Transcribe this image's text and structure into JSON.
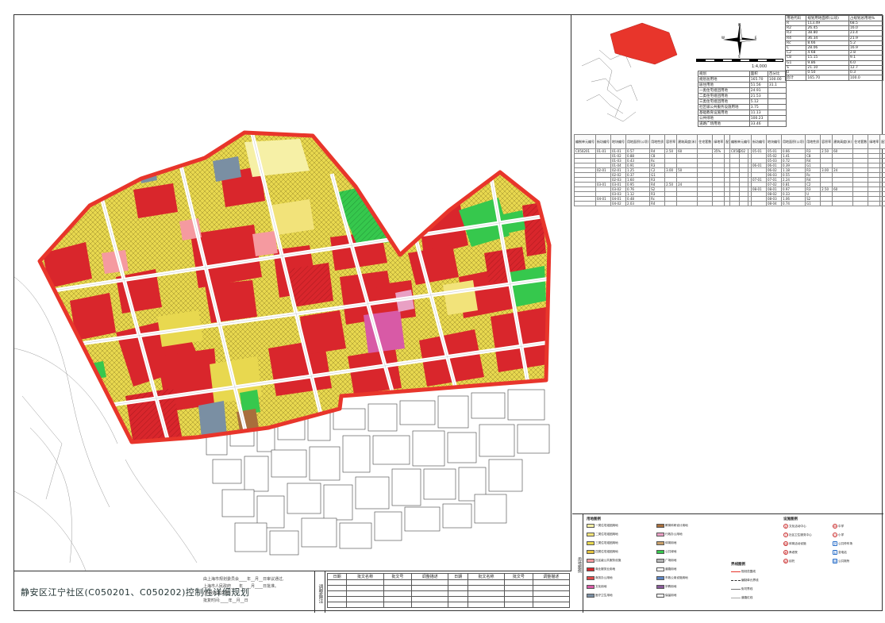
{
  "plan_title": "静安区江宁社区(C050201、C050202)控制性详细规划",
  "approval_lines": [
    "由上海市规划委员会____年__月__日审议通过,",
    "上海市人民政府____年____月____日批准。",
    "(市政府批文号)",
    "批复时间:____年__月__日"
  ],
  "adjust_label": "调整备注",
  "adjust_headers": [
    "日期",
    "批文名称",
    "批文号",
    "调整描述",
    "日期",
    "批文名称",
    "批文号",
    "调整描述"
  ],
  "scale_text": "1:4,000",
  "compass_labels": [
    "N",
    "S",
    "E",
    "W"
  ],
  "stats_rows": [
    [
      "规划",
      "面积",
      "百分比"
    ],
    [
      "规划总用地",
      "165.70",
      "100.00"
    ],
    [
      "居住用地",
      "51.56",
      "31.1"
    ],
    [
      "一类住宅组团用地",
      "24.91",
      ""
    ],
    [
      "二类住宅组团用地",
      "21.53",
      ""
    ],
    [
      "三类住宅组团用地",
      "5.12",
      ""
    ],
    [
      "社区级公共服务设施用地",
      "3.75",
      ""
    ],
    [
      "基础教育设施用地",
      "11.13",
      ""
    ],
    [
      "公共绿地",
      "100.23",
      ""
    ],
    [
      "道路广场用地",
      "33.46",
      ""
    ]
  ],
  "land_rows": [
    [
      "用地代码",
      "规划用地面积(公顷)",
      "占规划总用地%"
    ],
    [
      "R",
      "113.49",
      "68.5"
    ],
    [
      "R2",
      "26.45",
      "16.0"
    ],
    [
      "R3",
      "38.80",
      "23.4"
    ],
    [
      "R4",
      "36.34",
      "21.9"
    ],
    [
      "Rc",
      "8.66",
      "5.2"
    ],
    [
      "C",
      "28.06",
      "16.9"
    ],
    [
      "C2",
      "4.68",
      "2.8"
    ],
    [
      "C8",
      "15.15",
      "9.1"
    ],
    [
      "G1",
      "9.86",
      "6.0"
    ],
    [
      "S",
      "21.10",
      "12.7"
    ],
    [
      "U",
      "0.50",
      "0.3"
    ],
    [
      "合计",
      "165.70",
      "100.0"
    ]
  ],
  "block_table_headers": [
    "编制单元编号",
    "街坊编号",
    "地块编号",
    "用地面积(公顷)",
    "用地性质",
    "容积率",
    "建筑高度(米)",
    "住宅套数",
    "绿地率",
    "配套设施",
    "备注"
  ],
  "block_rows_left": [
    [
      "C050201",
      "01-01",
      "01-01",
      "0.57",
      "R4",
      "2.50",
      "60",
      "",
      "35%",
      "",
      ""
    ],
    [
      "",
      "",
      "01-02",
      "0.88",
      "C8",
      "",
      "",
      "",
      "",
      "",
      ""
    ],
    [
      "",
      "",
      "01-03",
      "0.43",
      "Rc",
      "",
      "",
      "",
      "",
      "",
      ""
    ],
    [
      "",
      "",
      "01-04",
      "0.91",
      "R3",
      "",
      "",
      "",
      "",
      "",
      ""
    ],
    [
      "",
      "02-01",
      "02-01",
      "1.25",
      "C2",
      "3.00",
      "50",
      "",
      "",
      "",
      ""
    ],
    [
      "",
      "",
      "02-02",
      "0.37",
      "G1",
      "",
      "",
      "",
      "",
      "",
      ""
    ],
    [
      "",
      "",
      "02-03",
      "1.60",
      "R3",
      "",
      "",
      "",
      "",
      "",
      ""
    ],
    [
      "",
      "03-01",
      "03-01",
      "0.95",
      "R4",
      "2.50",
      "24",
      "",
      "",
      "",
      ""
    ],
    [
      "",
      "",
      "03-02",
      "0.76",
      "S2",
      "",
      "",
      "",
      "",
      "",
      ""
    ],
    [
      "",
      "",
      "03-03",
      "1.12",
      "R3",
      "",
      "",
      "",
      "",
      "",
      ""
    ],
    [
      "",
      "04-01",
      "04-01",
      "0.48",
      "Rc",
      "",
      "",
      "",
      "",
      "",
      ""
    ],
    [
      "",
      "",
      "04-02",
      "2.03",
      "R4",
      "",
      "",
      "",
      "",
      "",
      ""
    ]
  ],
  "block_rows_right": [
    [
      "C050202",
      "05-01",
      "05-01",
      "0.66",
      "R3",
      "2.50",
      "60",
      "",
      "",
      "",
      ""
    ],
    [
      "",
      "",
      "05-02",
      "1.41",
      "C8",
      "",
      "",
      "",
      "",
      "",
      ""
    ],
    [
      "",
      "",
      "05-03",
      "0.72",
      "R4",
      "",
      "",
      "",
      "",
      "",
      ""
    ],
    [
      "",
      "06-01",
      "06-01",
      "0.39",
      "G1",
      "",
      "",
      "",
      "",
      "",
      ""
    ],
    [
      "",
      "",
      "06-02",
      "1.18",
      "R3",
      "3.00",
      "24",
      "",
      "",
      "",
      ""
    ],
    [
      "",
      "",
      "06-03",
      "0.55",
      "Rc",
      "",
      "",
      "",
      "",
      "",
      ""
    ],
    [
      "",
      "07-01",
      "07-01",
      "2.24",
      "R4",
      "",
      "",
      "",
      "",
      "",
      ""
    ],
    [
      "",
      "",
      "07-02",
      "0.81",
      "C2",
      "",
      "",
      "",
      "",
      "",
      ""
    ],
    [
      "",
      "08-01",
      "08-01",
      "0.97",
      "R3",
      "2.50",
      "60",
      "",
      "",
      "",
      ""
    ],
    [
      "",
      "",
      "08-02",
      "0.33",
      "U",
      "",
      "",
      "",
      "",
      "",
      ""
    ],
    [
      "",
      "",
      "08-03",
      "1.06",
      "S2",
      "",
      "",
      "",
      "",
      "",
      ""
    ],
    [
      "",
      "",
      "08-04",
      "0.74",
      "G1",
      "",
      "",
      "",
      "",
      "",
      ""
    ]
  ],
  "legend": {
    "side_label": "用地图例",
    "landuse_title": "用地图例",
    "items": [
      {
        "label": "一类住宅组团用地",
        "color": "#f6f0a6"
      },
      {
        "label": "二类住宅组团用地",
        "color": "#f2e37a"
      },
      {
        "label": "三类住宅组团用地",
        "color": "#e8d84f"
      },
      {
        "label": "四类住宅组团用地",
        "color": "#e3c23d"
      },
      {
        "label": "社区级公共服务设施",
        "color": "#f59aa0"
      },
      {
        "label": "商业服务业用地",
        "color": "#d9262c"
      },
      {
        "label": "商务办公用地",
        "color": "#e04a4a"
      },
      {
        "label": "文化用地",
        "color": "#d85aa6"
      },
      {
        "label": "医疗卫生用地",
        "color": "#7a8fa3"
      },
      {
        "label": "教育科研设计用地",
        "color": "#a86e3c"
      },
      {
        "label": "行政办公用地",
        "color": "#e9a0c4"
      },
      {
        "label": "体育用地",
        "color": "#c9a06a"
      },
      {
        "label": "公共绿地",
        "color": "#36c84d"
      },
      {
        "label": "广场用地",
        "color": "#b7b7b7"
      },
      {
        "label": "道路用地",
        "color": "#ffffff"
      },
      {
        "label": "市政公用设施用地",
        "color": "#5e86c4"
      },
      {
        "label": "宗教用地",
        "color": "#8a5a9a"
      },
      {
        "label": "保留用地",
        "color": "#f0f0f0"
      }
    ],
    "symbol_title": "设施图例",
    "symbols": [
      {
        "glyph": "文",
        "label": "文化活动中心"
      },
      {
        "glyph": "卫",
        "label": "社区卫生服务中心"
      },
      {
        "glyph": "体",
        "label": "体育活动设施"
      },
      {
        "glyph": "老",
        "label": "养老院"
      },
      {
        "glyph": "幼",
        "label": "幼托"
      },
      {
        "glyph": "中",
        "label": "中学"
      },
      {
        "glyph": "小",
        "label": "小学"
      },
      {
        "glyph": "P",
        "label": "公共停车场"
      },
      {
        "glyph": "E",
        "label": "变电站"
      },
      {
        "glyph": "W",
        "label": "公共厕所"
      }
    ],
    "boundary_title": "界线图例",
    "boundaries": [
      {
        "label": "规划范围线",
        "color": "#e8352b"
      },
      {
        "label": "编制单元界线",
        "color": "#333333"
      },
      {
        "label": "街坊界线",
        "color": "#777777"
      },
      {
        "label": "道路红线",
        "color": "#aaaaaa"
      }
    ]
  },
  "colors": {
    "boundary": "#e8352b",
    "road": "#ffffff",
    "site_red": "#d9262c",
    "residential": "#e8d84f",
    "green": "#36c84d"
  }
}
